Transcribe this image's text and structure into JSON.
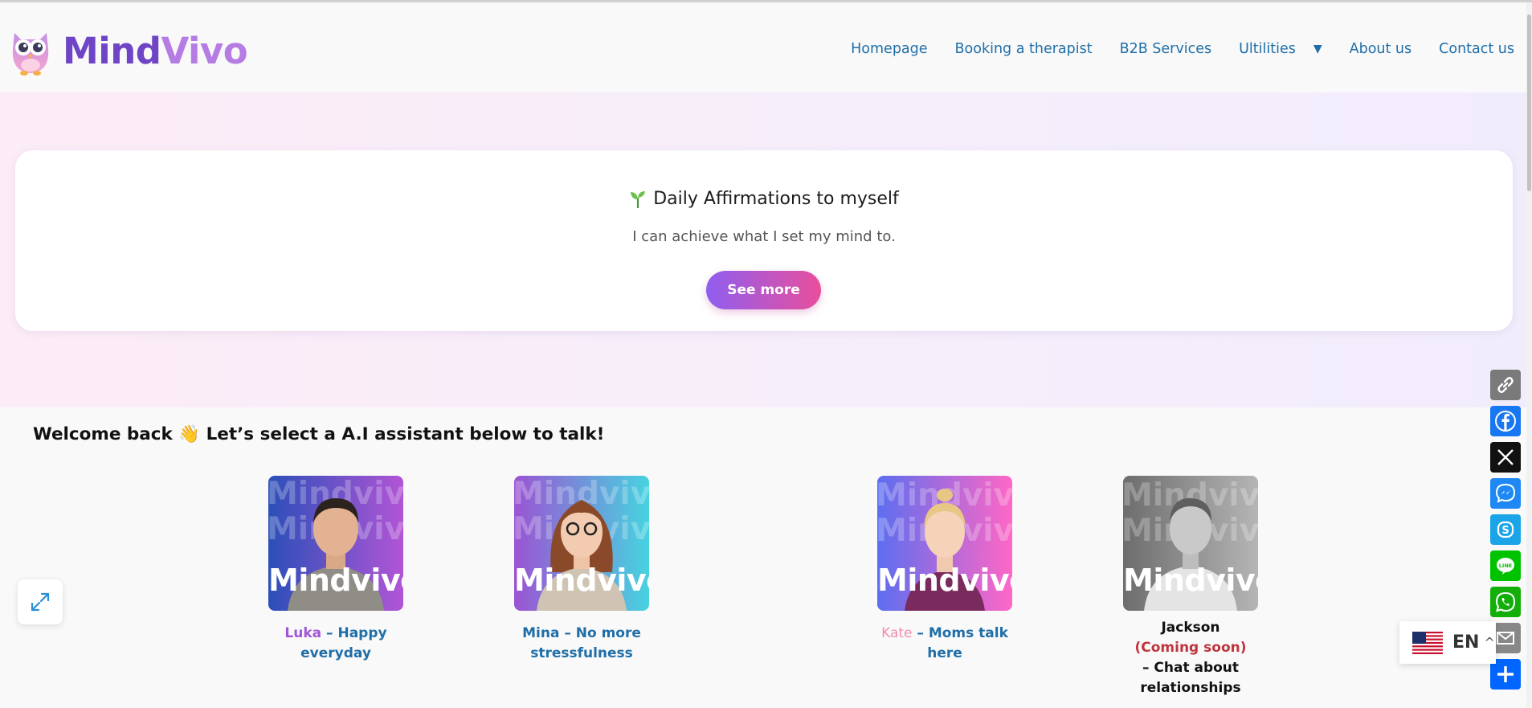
{
  "logo": {
    "text_part1": "Mind",
    "text_part2": "Vivo",
    "icon": "owl-logo"
  },
  "nav": {
    "items": [
      "Homepage",
      "Booking a therapist",
      "B2B Services",
      "Ultilities",
      "About us",
      "Contact us"
    ],
    "utilities_caret": "▼"
  },
  "affirmation": {
    "icon": "sprout-icon",
    "title": "Daily Affirmations to myself",
    "text": "I can achieve what I set my mind to.",
    "button": "See more"
  },
  "welcome": {
    "text": "Welcome back 👋 Let’s select a A.I assistant below to talk!"
  },
  "assistants": [
    {
      "brand": "Mindvivo",
      "name": "Luka",
      "sep": " – ",
      "tagline": "Happy everyday",
      "colors": [
        "#2b4fb8",
        "#b155d6"
      ]
    },
    {
      "brand": "Mindvivo",
      "name": "Mina",
      "sep": " – ",
      "tagline": "No more stressfulness",
      "colors": [
        "#9b54d3",
        "#46d3e0"
      ]
    },
    {
      "brand": "Mindvivo",
      "name": "Kate",
      "sep": " – ",
      "tagline": "Moms talk here",
      "colors": [
        "#5c6ef0",
        "#ff67c6"
      ]
    },
    {
      "brand": "Mindvivo",
      "name": "Jackson",
      "status": "(Coming soon)",
      "tagline": "– Chat about relationships",
      "colors": [
        "#6d6d6d",
        "#b5b5b5"
      ]
    }
  ],
  "share": [
    "link-icon",
    "facebook-icon",
    "x-icon",
    "messenger-icon",
    "skype-icon",
    "line-icon",
    "whatsapp-icon",
    "email-icon",
    "share-plus-icon"
  ],
  "language": {
    "code": "EN",
    "caret": "^"
  }
}
